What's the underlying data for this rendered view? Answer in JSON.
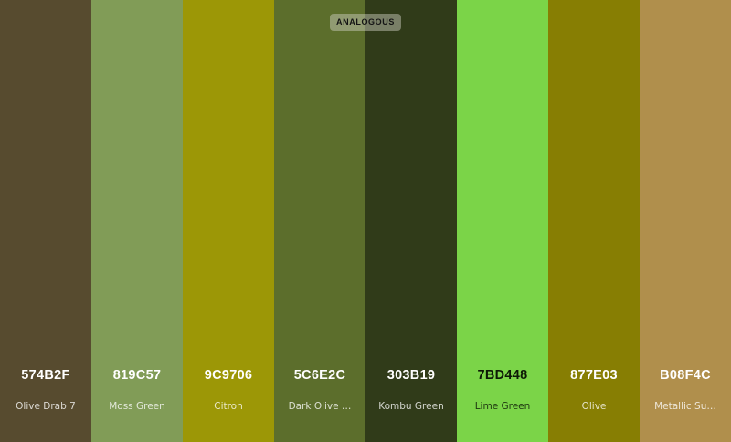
{
  "scheme": {
    "label": "ANALOGOUS"
  },
  "swatches": [
    {
      "hex": "574B2F",
      "name": "Olive Drab 7",
      "color": "#574b2f",
      "text_tone": "light"
    },
    {
      "hex": "819C57",
      "name": "Moss Green",
      "color": "#819c57",
      "text_tone": "light"
    },
    {
      "hex": "9C9706",
      "name": "Citron",
      "color": "#9c9706",
      "text_tone": "light"
    },
    {
      "hex": "5C6E2C",
      "name": "Dark Olive …",
      "color": "#5c6e2c",
      "text_tone": "light"
    },
    {
      "hex": "303B19",
      "name": "Kombu Green",
      "color": "#303b19",
      "text_tone": "light"
    },
    {
      "hex": "7BD448",
      "name": "Lime Green",
      "color": "#7bd448",
      "text_tone": "dark"
    },
    {
      "hex": "877E03",
      "name": "Olive",
      "color": "#877e03",
      "text_tone": "light"
    },
    {
      "hex": "B08F4C",
      "name": "Metallic Su…",
      "color": "#b08f4c",
      "text_tone": "light"
    }
  ]
}
